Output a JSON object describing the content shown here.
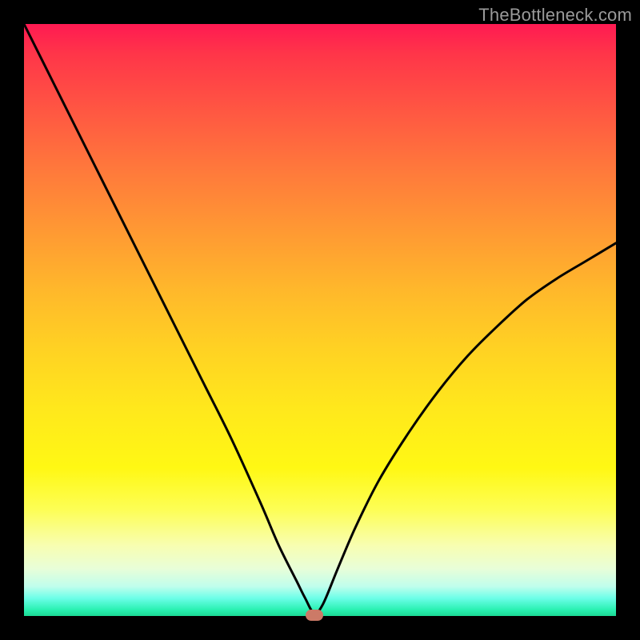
{
  "watermark": "TheBottleneck.com",
  "chart_data": {
    "type": "line",
    "title": "",
    "xlabel": "",
    "ylabel": "",
    "xlim": [
      0,
      100
    ],
    "ylim": [
      0,
      100
    ],
    "x": [
      0,
      5,
      10,
      15,
      20,
      25,
      30,
      35,
      40,
      43,
      46,
      47.5,
      49,
      50.5,
      53,
      56,
      60,
      65,
      70,
      75,
      80,
      85,
      90,
      95,
      100
    ],
    "values": [
      100,
      90,
      80,
      70,
      60,
      50,
      40,
      30,
      19,
      12,
      6,
      3,
      0.5,
      2,
      8,
      15,
      23,
      31,
      38,
      44,
      49,
      53.5,
      57,
      60,
      63
    ],
    "marker": {
      "x": 49,
      "y": 0.2
    },
    "gradient_description": "vertical rainbow gradient: red at top through orange, yellow, pale yellow to teal-green at bottom"
  },
  "colors": {
    "background": "#000000",
    "curve": "#000000",
    "marker": "#cc7a67",
    "watermark": "#9a9a9a"
  }
}
